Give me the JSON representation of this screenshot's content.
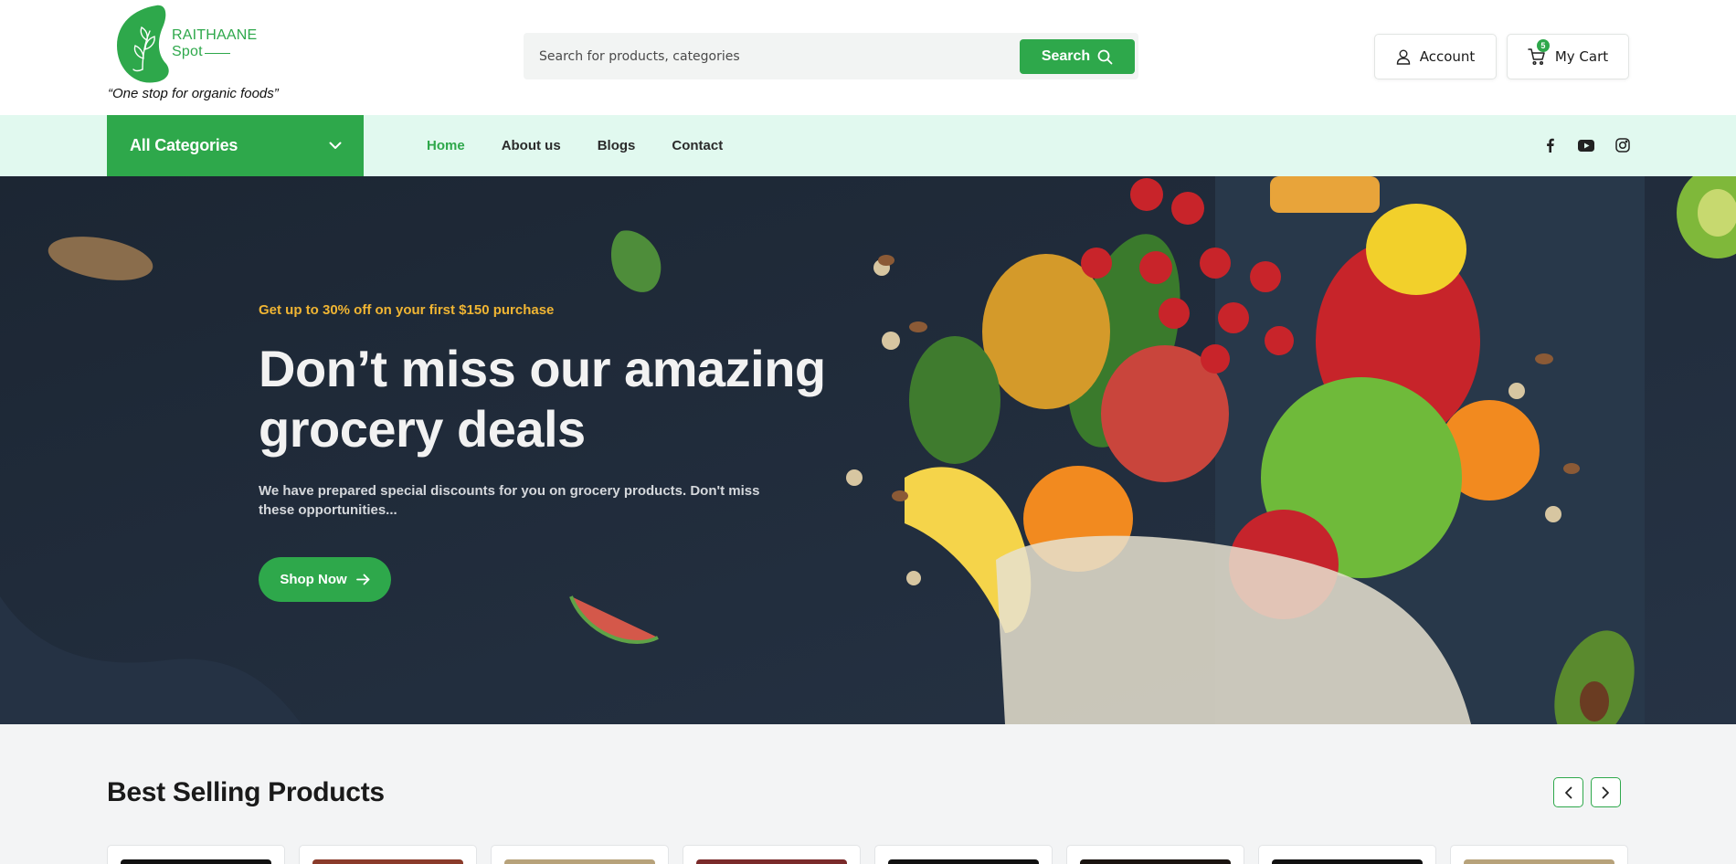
{
  "header": {
    "logo": {
      "line1": "RAITHAANE",
      "line2": "Spot"
    },
    "tagline": "“One stop for organic foods”",
    "search": {
      "placeholder": "Search for products, categories",
      "button_label": "Search"
    },
    "account_label": "Account",
    "cart": {
      "label": "My Cart",
      "count": "5"
    }
  },
  "nav": {
    "all_categories_label": "All Categories",
    "links": [
      {
        "label": "Home",
        "active": true
      },
      {
        "label": "About us",
        "active": false
      },
      {
        "label": "Blogs",
        "active": false
      },
      {
        "label": "Contact",
        "active": false
      }
    ],
    "social_icons": [
      "facebook-icon",
      "youtube-icon",
      "instagram-icon"
    ]
  },
  "hero": {
    "promo": "Get up to 30% off on your first $150 purchase",
    "title": "Don’t miss our amazing grocery deals",
    "description": "We have prepared special discounts for you on grocery products. Don't miss these opportunities...",
    "cta_label": "Shop Now"
  },
  "best_selling": {
    "title": "Best Selling Products",
    "cards": 9
  },
  "colors": {
    "brand_green": "#2ea84b",
    "nav_bg": "#e1f9ef",
    "promo_yellow": "#f0b533",
    "hero_bg": "#1f2a38"
  }
}
